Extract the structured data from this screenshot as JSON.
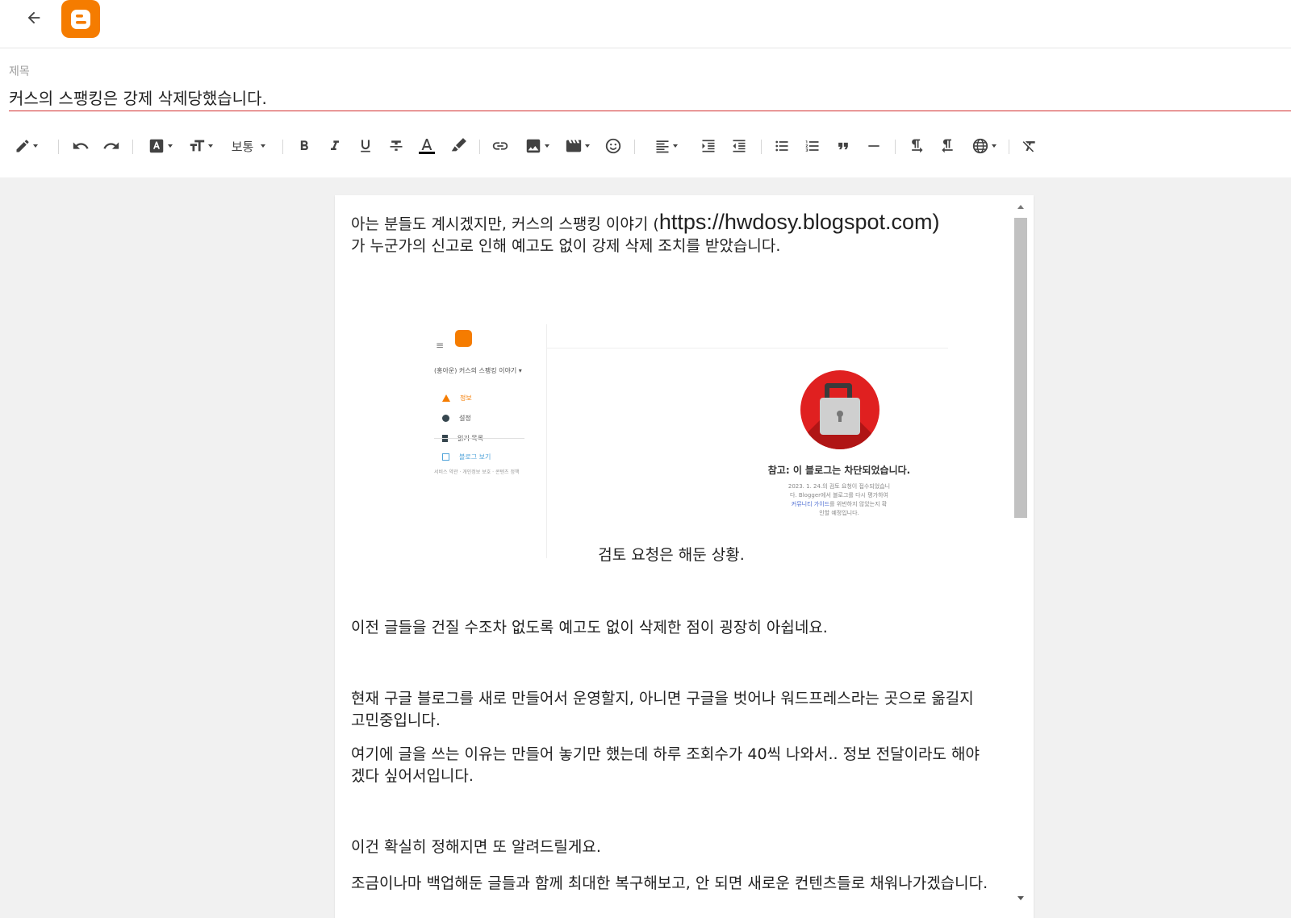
{
  "header": {
    "back_label": "back",
    "logo": "blogger-logo"
  },
  "title": {
    "label": "제목",
    "value": "커스의 스팽킹은 강제 삭제당했습니다."
  },
  "toolbar": {
    "paragraph_style_label": "보통",
    "icons": [
      "pencil-icon",
      "undo-icon",
      "redo-icon",
      "font-icon",
      "font-size-icon",
      "bold-icon",
      "italic-icon",
      "underline-icon",
      "strikethrough-icon",
      "text-color-icon",
      "highlight-icon",
      "link-icon",
      "image-icon",
      "video-icon",
      "emoji-icon",
      "align-icon",
      "indent-icon",
      "outdent-icon",
      "bulleted-list-icon",
      "numbered-list-icon",
      "quote-icon",
      "horizontal-rule-icon",
      "ltr-icon",
      "rtl-icon",
      "language-icon",
      "clear-format-icon"
    ]
  },
  "body": {
    "p1_text": "아는 분들도 계시겠지만, 커스의 스팽킹 이야기 (",
    "p1_url": "https://hwdosy.blogspot.com)",
    "p1_cont": "가 누군가의 신고로 인해 예고도 없이 강제 삭제 조치를 받았습니다.",
    "image": {
      "hamburger": "≡",
      "blog_name": "(홍아운) 커스의 스팽킹 이야기 ▾",
      "menu": [
        "정보",
        "설정",
        "읽기 목록",
        "블로그 보기"
      ],
      "footer": "서비스 약관 · 개인정보 보호 · 콘텐츠 정책",
      "notice_title": "참고: 이 블로그는 차단되었습니다.",
      "notice_line1": "2023. 1. 24.의 검토 요청이 접수되었습니",
      "notice_line2": "다. Blogger에서 블로그를 다시 평가하여",
      "notice_link": "커뮤니티 가이드",
      "notice_line3": "를 위반하지 않았는지 확",
      "notice_line4": "인할 예정입니다."
    },
    "caption": "검토 요청은 해둔 상황.",
    "p2": "이전 글들을 건질 수조차 없도록 예고도 없이 삭제한 점이 굉장히 아쉽네요.",
    "p3": "현재 구글 블로그를 새로 만들어서 운영할지, 아니면 구글을 벗어나 워드프레스라는 곳으로 옮길지 고민중입니다.",
    "p4": "여기에 글을 쓰는 이유는 만들어 놓기만 했는데 하루 조회수가 40씩 나와서.. 정보 전달이라도 해야겠다 싶어서입니다.",
    "p5": "이건 확실히 정해지면 또 알려드릴게요.",
    "p6": "조금이나마 백업해둔 글들과 함께 최대한 복구해보고, 안 되면 새로운 컨텐츠들로 채워나가겠습니다."
  },
  "colors": {
    "accent": "#f57c00",
    "title_underline": "#d32f2f",
    "lock_red": "#e02020"
  }
}
